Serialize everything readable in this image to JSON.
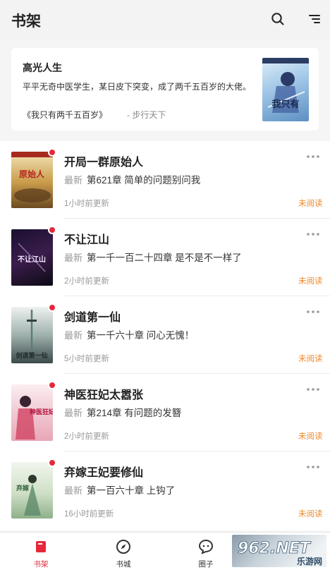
{
  "header": {
    "title": "书架",
    "search_icon": "search-icon",
    "menu_icon": "menu-icon"
  },
  "featured": {
    "title": "高光人生",
    "description": "平平无奇中医学生，某日皮下突变，成了两千五百岁的大佬。",
    "book": "《我只有两千五百岁》",
    "author": "- 步行天下",
    "cover_text": "我只有"
  },
  "books": [
    {
      "title": "开局一群原始人",
      "latest_label": "最新",
      "chapter": "第621章 简单的问题别问我",
      "updated": "1小时前更新",
      "status": "未阅读",
      "cover_text": "原始人"
    },
    {
      "title": "不让江山",
      "latest_label": "最新",
      "chapter": "第一千一百二十四章 是不是不一样了",
      "updated": "2小时前更新",
      "status": "未阅读",
      "cover_text": "不让江山"
    },
    {
      "title": "剑道第一仙",
      "latest_label": "最新",
      "chapter": "第一千六十章 问心无愧！",
      "updated": "5小时前更新",
      "status": "未阅读",
      "cover_text": "剑道第一仙"
    },
    {
      "title": "神医狂妃太嚣张",
      "latest_label": "最新",
      "chapter": "第214章 有问题的发簪",
      "updated": "2小时前更新",
      "status": "未阅读",
      "cover_text": "神医狂妃"
    },
    {
      "title": "弃嫁王妃要修仙",
      "latest_label": "最新",
      "chapter": "第一百六十章 上钩了",
      "updated": "16小时前更新",
      "status": "未阅读",
      "cover_text": "弃嫁"
    }
  ],
  "nav": [
    {
      "label": "书架",
      "icon": "bookshelf-icon",
      "active": true
    },
    {
      "label": "书城",
      "icon": "compass-icon",
      "active": false
    },
    {
      "label": "圈子",
      "icon": "chat-bubble-icon",
      "active": false
    }
  ],
  "watermark": {
    "text": "962.NET",
    "sub": "乐游网"
  },
  "colors": {
    "accent": "#e6283a",
    "unread": "#f08a2c",
    "background": "#f5f5f5"
  }
}
